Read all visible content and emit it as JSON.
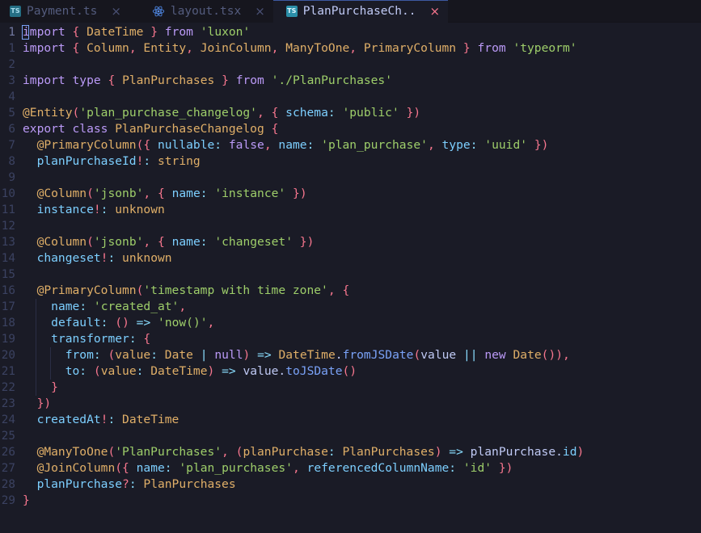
{
  "window": {
    "theme": "tokyo-night",
    "bg": "#1a1b26",
    "tabbar_bg": "#16161e"
  },
  "tabs": [
    {
      "label": "Payment.ts",
      "icon": "typescript-file-icon",
      "active": false,
      "close_label": "×"
    },
    {
      "label": "layout.tsx",
      "icon": "react-file-icon",
      "active": false,
      "close_label": "×"
    },
    {
      "label": "PlanPurchaseCh..",
      "icon": "typescript-file-icon",
      "active": true,
      "close_label": "×"
    }
  ],
  "editor": {
    "language": "TypeScript",
    "cursor_line": 1,
    "cursor_column": 1,
    "line_numbers": [
      "1",
      "1",
      "2",
      "3",
      "4",
      "5",
      "6",
      "7",
      "8",
      "9",
      "10",
      "11",
      "12",
      "13",
      "14",
      "15",
      "16",
      "17",
      "18",
      "19",
      "20",
      "21",
      "22",
      "23",
      "24",
      "25",
      "26",
      "27",
      "28",
      "29"
    ],
    "lines": [
      "import { DateTime } from 'luxon'",
      "import { Column, Entity, JoinColumn, ManyToOne, PrimaryColumn } from 'typeorm'",
      "",
      "import type { PlanPurchases } from './PlanPurchases'",
      "",
      "@Entity('plan_purchase_changelog', { schema: 'public' })",
      "export class PlanPurchaseChangelog {",
      "  @PrimaryColumn({ nullable: false, name: 'plan_purchase', type: 'uuid' })",
      "  planPurchaseId!: string",
      "",
      "  @Column('jsonb', { name: 'instance' })",
      "  instance!: unknown",
      "",
      "  @Column('jsonb', { name: 'changeset' })",
      "  changeset!: unknown",
      "",
      "  @PrimaryColumn('timestamp with time zone', {",
      "    name: 'created_at',",
      "    default: () => 'now()',",
      "    transformer: {",
      "      from: (value: Date | null) => DateTime.fromJSDate(value || new Date()),",
      "      to: (value: DateTime) => value.toJSDate()",
      "    }",
      "  })",
      "  createdAt!: DateTime",
      "",
      "  @ManyToOne('PlanPurchases', (planPurchase: PlanPurchases) => planPurchase.id)",
      "  @JoinColumn({ name: 'plan_purchases', referencedColumnName: 'id' })",
      "  planPurchase?: PlanPurchases",
      "}"
    ]
  },
  "colors": {
    "background": "#1a1b26",
    "foreground": "#a9b1d6",
    "keyword": "#bb9af7",
    "string": "#9ece6a",
    "type": "#e0af68",
    "function": "#7aa2f7",
    "property": "#7dcfff",
    "punctuation": "#f7768e",
    "operator": "#89ddff",
    "line_number": "#3b4261",
    "cursor": "#7aa2f7",
    "tab_active_fg": "#c0caf5",
    "tab_inactive_fg": "#545c7e"
  }
}
